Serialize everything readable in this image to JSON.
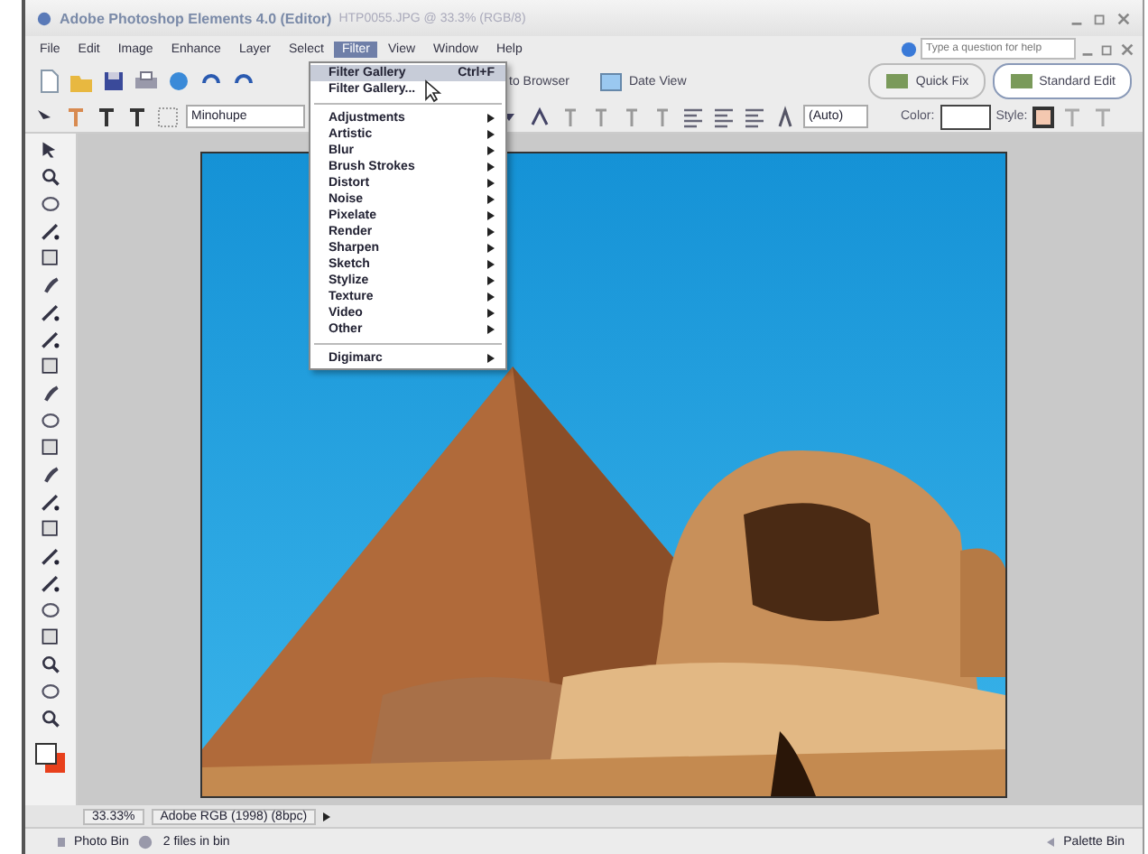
{
  "window": {
    "title": "Adobe Photoshop Elements 4.0 (Editor)",
    "document": "HTP0055.JPG @ 33.3% (RGB/8)"
  },
  "menu_bar": [
    {
      "label": "File",
      "selected": false
    },
    {
      "label": "Edit",
      "selected": false
    },
    {
      "label": "Image",
      "selected": false
    },
    {
      "label": "Enhance",
      "selected": false
    },
    {
      "label": "Layer",
      "selected": false
    },
    {
      "label": "Select",
      "selected": false
    },
    {
      "label": "Filter",
      "selected": true
    },
    {
      "label": "View",
      "selected": false
    },
    {
      "label": "Window",
      "selected": false
    },
    {
      "label": "Help",
      "selected": false
    }
  ],
  "help_field": {
    "placeholder": "Type a question for help"
  },
  "toolbar": {
    "buttons": [
      "to Browser",
      "Date View"
    ],
    "modes": [
      {
        "label": "Quick Fix",
        "selected": false
      },
      {
        "label": "Standard Edit",
        "selected": true
      }
    ]
  },
  "options_bar": {
    "font": "Minohupe",
    "leading": "(Auto)",
    "color_label": "Color:",
    "style_label": "Style:"
  },
  "filter_menu": [
    {
      "kind": "command",
      "label": "Filter Gallery",
      "shortcut": "Ctrl+F",
      "selected": true
    },
    {
      "kind": "command",
      "label": "Filter Gallery...",
      "selected": false
    },
    {
      "kind": "separator"
    },
    {
      "kind": "submenu",
      "label": "Adjustments",
      "selected": false
    },
    {
      "kind": "submenu",
      "label": "Artistic",
      "selected": false
    },
    {
      "kind": "submenu",
      "label": "Blur",
      "selected": false
    },
    {
      "kind": "submenu",
      "label": "Brush Strokes",
      "selected": false
    },
    {
      "kind": "submenu",
      "label": "Distort",
      "selected": false
    },
    {
      "kind": "submenu",
      "label": "Noise",
      "selected": false
    },
    {
      "kind": "submenu",
      "label": "Pixelate",
      "selected": false
    },
    {
      "kind": "submenu",
      "label": "Render",
      "selected": false
    },
    {
      "kind": "submenu",
      "label": "Sharpen",
      "selected": false
    },
    {
      "kind": "submenu",
      "label": "Sketch",
      "selected": false
    },
    {
      "kind": "submenu",
      "label": "Stylize",
      "selected": false
    },
    {
      "kind": "submenu",
      "label": "Texture",
      "selected": false
    },
    {
      "kind": "submenu",
      "label": "Video",
      "selected": false
    },
    {
      "kind": "submenu",
      "label": "Other",
      "selected": false
    },
    {
      "kind": "separator"
    },
    {
      "kind": "submenu",
      "label": "Digimarc",
      "selected": false
    }
  ],
  "status_bar": {
    "zoom": "33.33%",
    "profile": "Adobe RGB (1998) (8bpc)"
  },
  "bin_bar": {
    "photo_bin": "Photo Bin",
    "files": "2 files in bin",
    "palette_bin": "Palette Bin"
  }
}
